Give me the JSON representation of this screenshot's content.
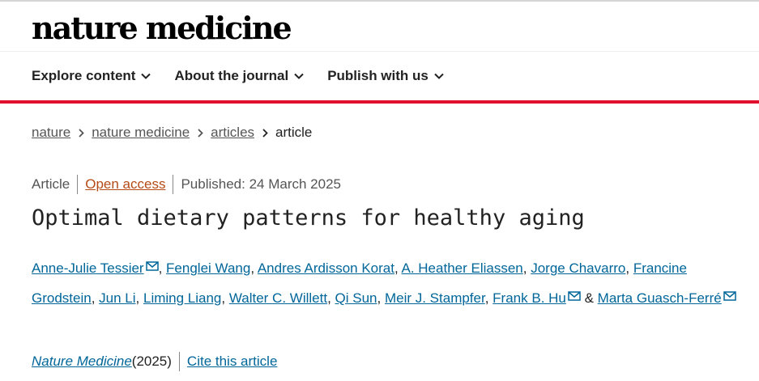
{
  "header": {
    "logo": "nature medicine"
  },
  "nav": {
    "items": [
      {
        "label": "Explore content"
      },
      {
        "label": "About the journal"
      },
      {
        "label": "Publish with us"
      }
    ]
  },
  "breadcrumb": {
    "items": [
      "nature",
      "nature medicine",
      "articles"
    ],
    "current": "article"
  },
  "meta": {
    "type": "Article",
    "access": "Open access",
    "published": "Published: 24 March 2025"
  },
  "title": "Optimal dietary patterns for healthy aging",
  "authors": [
    {
      "name": "Anne-Julie Tessier",
      "email": true
    },
    {
      "name": "Fenglei Wang"
    },
    {
      "name": "Andres Ardisson Korat"
    },
    {
      "name": "A. Heather Eliassen"
    },
    {
      "name": "Jorge Chavarro"
    },
    {
      "name": "Francine Grodstein"
    },
    {
      "name": "Jun Li"
    },
    {
      "name": "Liming Liang"
    },
    {
      "name": "Walter C. Willett"
    },
    {
      "name": "Qi Sun"
    },
    {
      "name": "Meir J. Stampfer"
    },
    {
      "name": "Frank B. Hu",
      "email": true
    },
    {
      "name": "Marta Guasch-Ferré",
      "email": true
    }
  ],
  "authors_last_joiner": " & ",
  "citation": {
    "journal": "Nature Medicine",
    "year": " (2025)",
    "cite_label": "Cite this article"
  }
}
